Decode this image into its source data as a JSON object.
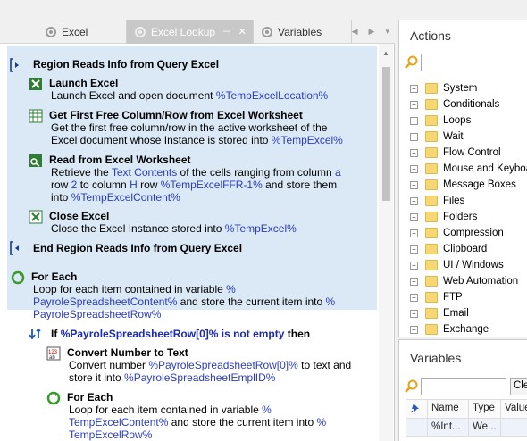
{
  "tabs": [
    {
      "label": "Excel",
      "active": false
    },
    {
      "label": "Excel Lookup",
      "active": true
    },
    {
      "label": "Variables",
      "active": false
    }
  ],
  "editor": {
    "region_start": "Region Reads Info from Query Excel",
    "launch": {
      "title": "Launch Excel",
      "desc": "Launch Excel and open document ",
      "var": "%TempExcelLocation%"
    },
    "firstfree": {
      "title": "Get First Free Column/Row from Excel Worksheet",
      "desc1": "Get the first free column/row in the active worksheet of the",
      "desc2": "Excel document whose Instance is stored into ",
      "var": "%TempExcel%"
    },
    "read": {
      "title": "Read from Excel Worksheet",
      "d1a": "Retrieve the ",
      "d1b": "Text Contents",
      "d1c": " of the cells ranging from column ",
      "d1d": "a",
      "d2a": "row ",
      "d2b": "2",
      "d2c": " to column ",
      "d2d": "H",
      "d2e": " row ",
      "d2f": "%TempExcelFFR-1%",
      "d2g": " and store them",
      "d3a": "into ",
      "d3b": "%TempExcelContent%"
    },
    "close": {
      "title": "Close Excel",
      "desc": "Close the Excel Instance stored into ",
      "var": "%TempExcel%"
    },
    "region_end": "End Region Reads Info from Query Excel",
    "foreach1": {
      "title": "For Each",
      "d1": "Loop for each item contained in variable ",
      "d1v": "%",
      "d2v": "PayroleSpreadsheetContent%",
      "d2": " and store the current item into ",
      "d2v2": "%",
      "d3v": "PayroleSpreadsheetRow%"
    },
    "if": {
      "kw": "If",
      "cond": "%PayroleSpreadsheetRow[0]% is not empty",
      "then": "then"
    },
    "convert": {
      "title": "Convert Number to Text",
      "d1": "Convert number ",
      "d1v": "%PayroleSpreadsheetRow[0]%",
      "d1b": " to text and",
      "d2": "store it into ",
      "d2v": "%PayroleSpreadsheetEmplID%"
    },
    "foreach2": {
      "title": "For Each",
      "d1": "Loop for each item contained in variable ",
      "d1v": "%",
      "d2v": "TempExcelContent%",
      "d2": " and store the current item into ",
      "d2v2": "%",
      "d3v": "TempExcelRow%"
    }
  },
  "actions": {
    "title": "Actions",
    "search_placeholder": "",
    "items": [
      "System",
      "Conditionals",
      "Loops",
      "Wait",
      "Flow Control",
      "Mouse and Keyboard",
      "Message Boxes",
      "Files",
      "Folders",
      "Compression",
      "Clipboard",
      "UI / Windows",
      "Web Automation",
      "FTP",
      "Email",
      "Exchange"
    ]
  },
  "variables": {
    "title": "Variables",
    "clear_label": "Clear",
    "columns": [
      "Name",
      "Type",
      "Value"
    ],
    "row": {
      "name": "%Int...",
      "type": "We..."
    }
  },
  "colors": {
    "region_bg": "#dbe9f6",
    "var_blue": "#2b3cbf",
    "tab_active": "#c8c8c8"
  }
}
